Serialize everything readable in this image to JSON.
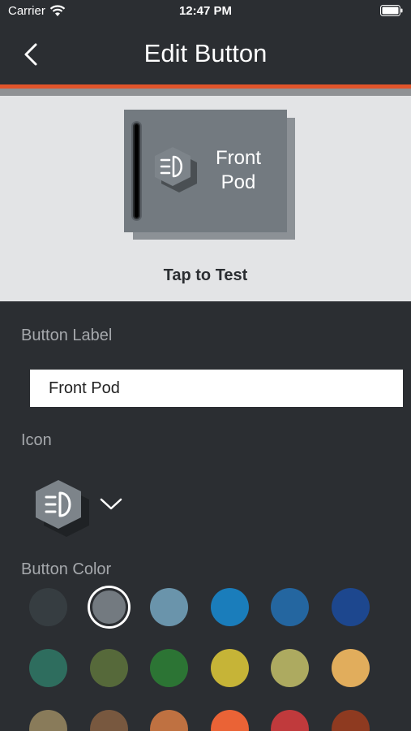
{
  "status_bar": {
    "carrier": "Carrier",
    "time": "12:47 PM"
  },
  "nav": {
    "title": "Edit Button"
  },
  "preview": {
    "label": "Front\nPod",
    "tap_to_test": "Tap to Test",
    "icon": "headlight-icon"
  },
  "form": {
    "button_label_heading": "Button Label",
    "button_label_value": "Front Pod",
    "icon_heading": "Icon",
    "selected_icon": "headlight-icon",
    "button_color_heading": "Button Color"
  },
  "colors": {
    "accent": "#e1542a",
    "background": "#2b2e32",
    "preview_button": "#737a80",
    "swatches": [
      "#363d41",
      "#737a80",
      "#6a94ab",
      "#1a7dbb",
      "#2466a0",
      "#1d478e",
      "#2e6d5e",
      "#56693a",
      "#2c7434",
      "#c6b437",
      "#adaa60",
      "#e1ad5c",
      "#897b5a",
      "#78583f",
      "#bf7141",
      "#ea6336",
      "#c03a3c",
      "#8e3a20"
    ],
    "selected_swatch_index": 1
  }
}
